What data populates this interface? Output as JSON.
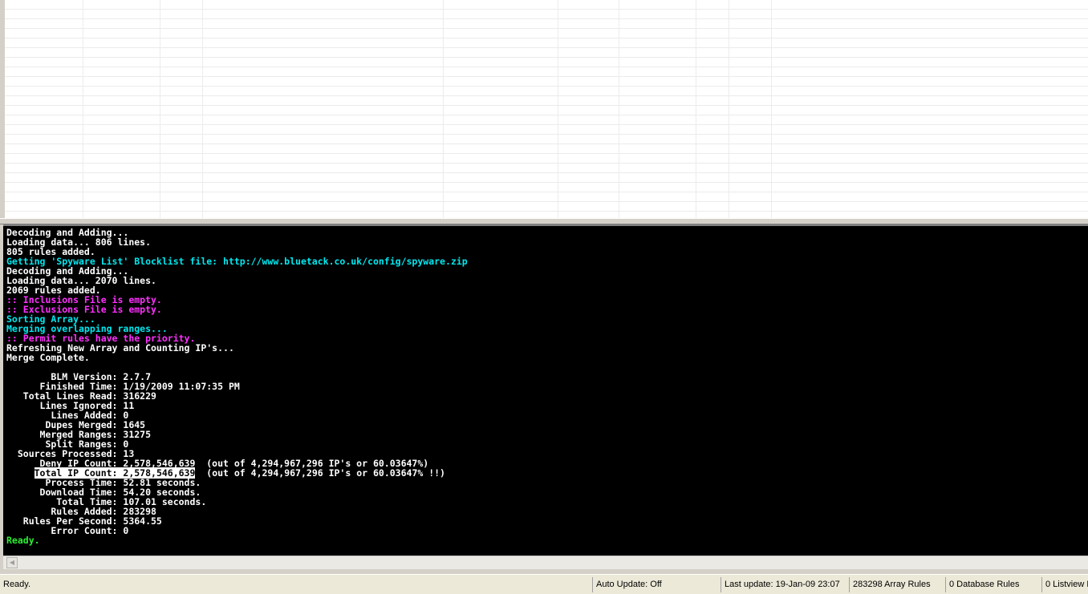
{
  "console": {
    "lines": [
      {
        "color": "white",
        "text": "Decoding and Adding..."
      },
      {
        "color": "white",
        "text": "Loading data... 806 lines."
      },
      {
        "color": "white",
        "text": "805 rules added."
      },
      {
        "color": "cyan",
        "text": "Getting 'Spyware List' Blocklist file: http://www.bluetack.co.uk/config/spyware.zip"
      },
      {
        "color": "white",
        "text": "Decoding and Adding..."
      },
      {
        "color": "white",
        "text": "Loading data... 2070 lines."
      },
      {
        "color": "white",
        "text": "2069 rules added."
      },
      {
        "color": "magenta",
        "text": ":: Inclusions File is empty."
      },
      {
        "color": "magenta",
        "text": ":: Exclusions File is empty."
      },
      {
        "color": "cyan",
        "text": "Sorting Array..."
      },
      {
        "color": "cyan",
        "text": "Merging overlapping ranges..."
      },
      {
        "color": "magenta",
        "text": ":: Permit rules have the priority."
      },
      {
        "color": "white",
        "text": "Refreshing New Array and Counting IP's..."
      },
      {
        "color": "white",
        "text": "Merge Complete."
      },
      {
        "color": "white",
        "text": ""
      },
      {
        "color": "white",
        "text": "        BLM Version: 2.7.7"
      },
      {
        "color": "white",
        "text": "      Finished Time: 1/19/2009 11:07:35 PM"
      },
      {
        "color": "white",
        "text": "   Total Lines Read: 316229"
      },
      {
        "color": "white",
        "text": "      Lines Ignored: 11"
      },
      {
        "color": "white",
        "text": "        Lines Added: 0"
      },
      {
        "color": "white",
        "text": "       Dupes Merged: 1645"
      },
      {
        "color": "white",
        "text": "      Merged Ranges: 31275"
      },
      {
        "color": "white",
        "text": "       Split Ranges: 0"
      },
      {
        "color": "white",
        "text": "  Sources Processed: 13"
      },
      {
        "color": "white",
        "text": "      Deny IP Count: 2,578,546,639  (out of 4,294,967,296 IP's or 60.03647%)"
      },
      {
        "color": "white",
        "pre": "     ",
        "hl": "Total IP Count: 2,578,546,639",
        "text": "  (out of 4,294,967,296 IP's or 60.03647% !!)"
      },
      {
        "color": "white",
        "text": "       Process Time: 52.81 seconds."
      },
      {
        "color": "white",
        "text": "      Download Time: 54.20 seconds."
      },
      {
        "color": "white",
        "text": "         Total Time: 107.01 seconds."
      },
      {
        "color": "white",
        "text": "        Rules Added: 283298"
      },
      {
        "color": "white",
        "text": "   Rules Per Second: 5364.55"
      },
      {
        "color": "white",
        "text": "        Error Count: 0"
      },
      {
        "color": "green",
        "text": "Ready."
      }
    ]
  },
  "statusbar": {
    "status": "Ready.",
    "auto_update": "Auto Update: Off",
    "last_update": "Last update: 19-Jan-09 23:07",
    "array_rules": "283298 Array Rules",
    "database_rules": "0 Database Rules",
    "listview": "0 Listview R"
  },
  "icons": {
    "scroll_left": "left-arrow-icon"
  }
}
